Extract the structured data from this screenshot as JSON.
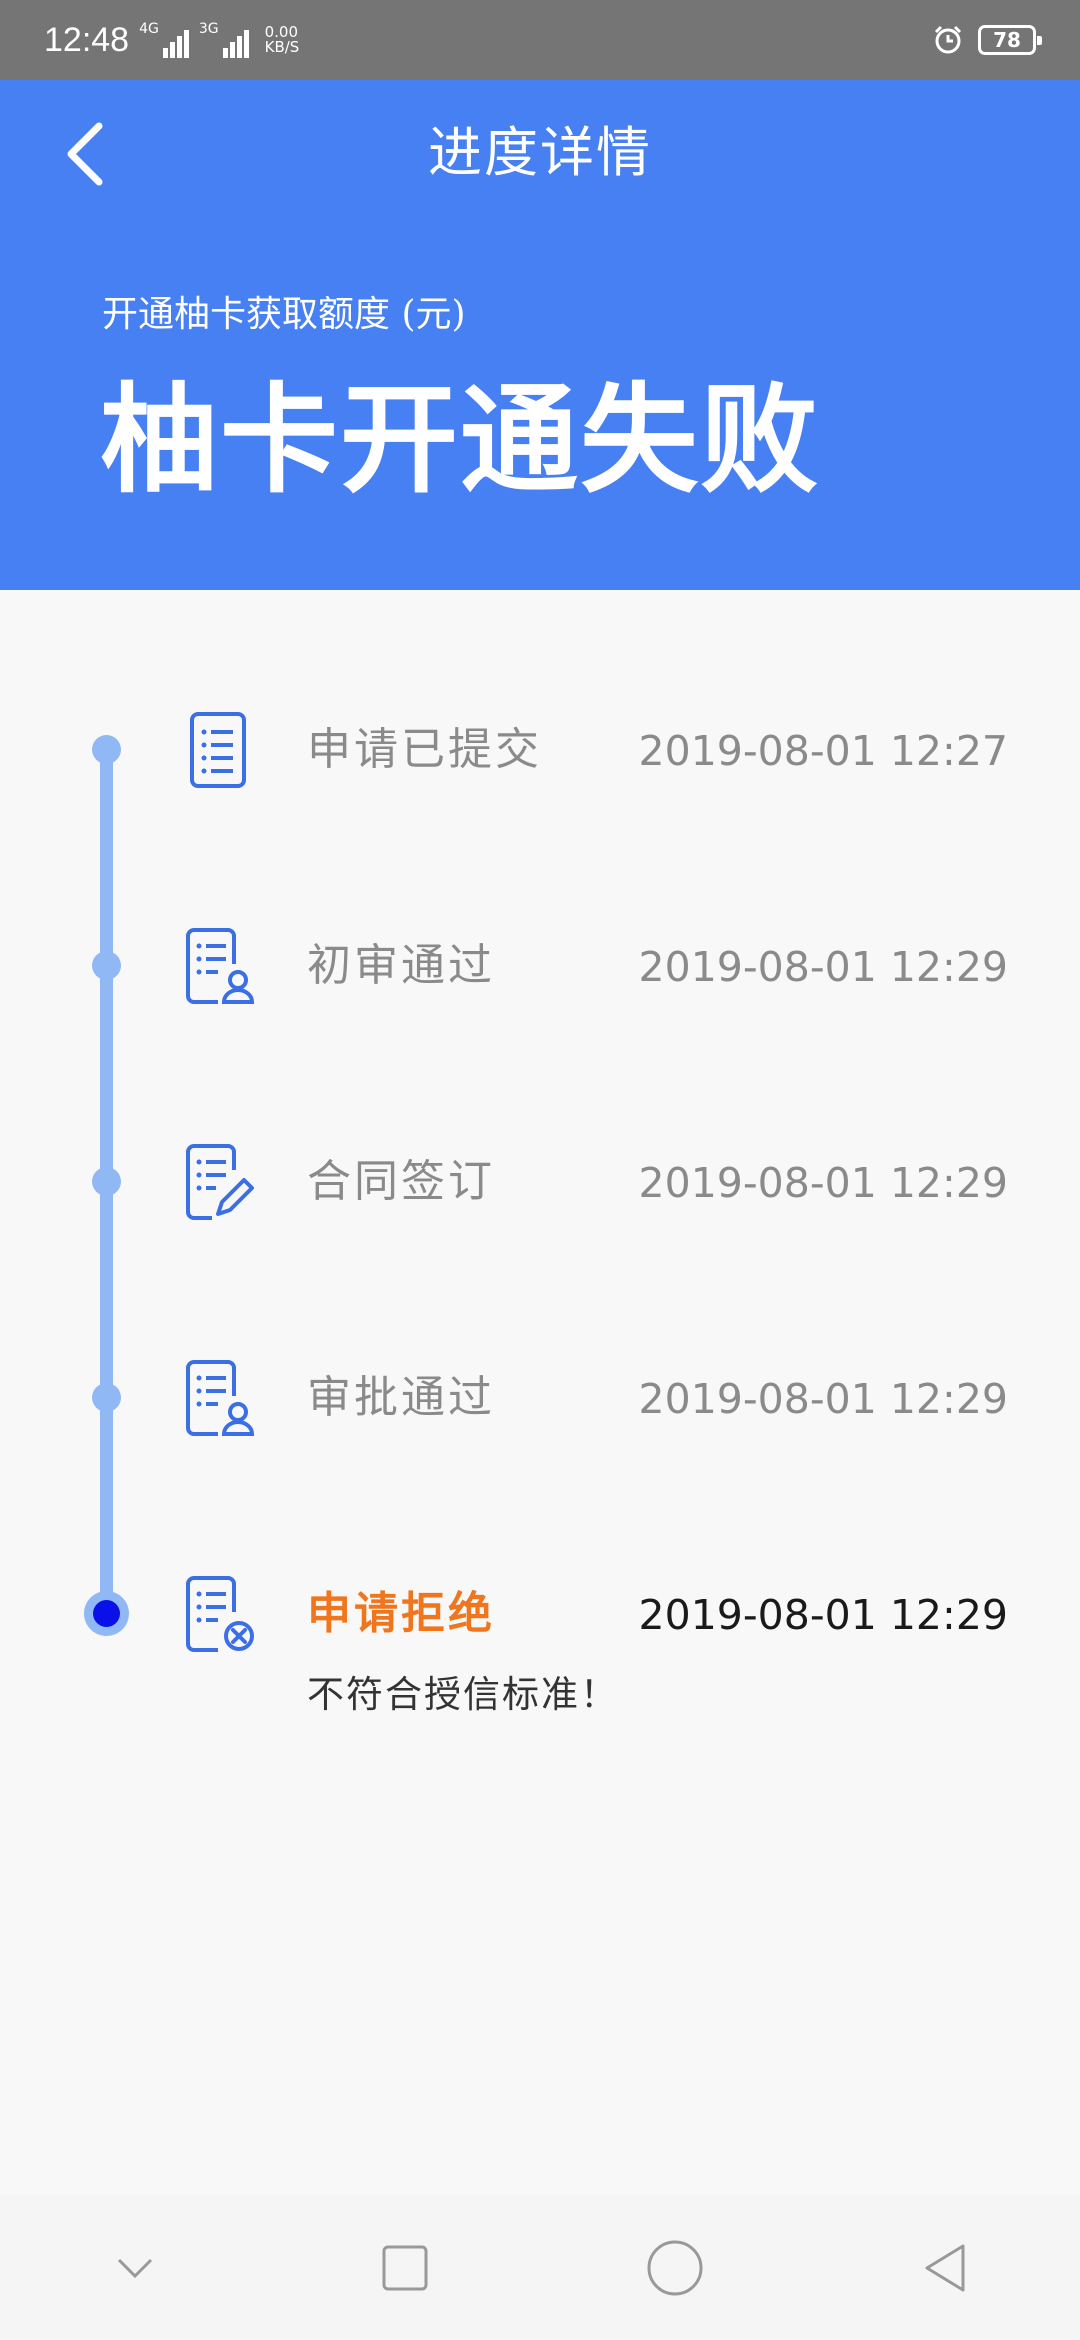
{
  "status_bar": {
    "time": "12:48",
    "network_1": "4G",
    "network_2": "3G",
    "speed_value": "0.00",
    "speed_unit": "KB/S",
    "battery": "78",
    "icons": [
      "signal-icon",
      "signal-icon",
      "alarm-icon",
      "battery-icon"
    ]
  },
  "header": {
    "title": "进度详情",
    "subtitle": "开通柚卡获取额度 (元)",
    "status": "柚卡开通失败",
    "color": "#4780f2"
  },
  "timeline": {
    "steps": [
      {
        "label": "申请已提交",
        "time": "2019-08-01 12:27",
        "icon": "document-list-icon"
      },
      {
        "label": "初审通过",
        "time": "2019-08-01 12:29",
        "icon": "document-user-icon"
      },
      {
        "label": "合同签订",
        "time": "2019-08-01 12:29",
        "icon": "document-sign-icon"
      },
      {
        "label": "审批通过",
        "time": "2019-08-01 12:29",
        "icon": "document-user-icon"
      },
      {
        "label": "申请拒绝",
        "time": "2019-08-01 12:29",
        "icon": "document-reject-icon",
        "reason": "不符合授信标准！"
      }
    ],
    "colors": {
      "line": "#8fb8f5",
      "active_dot": "#0a10e8",
      "reject": "#f0761e"
    }
  },
  "nav_bar": {
    "icons": [
      "chevron-down-icon",
      "square-icon",
      "circle-icon",
      "triangle-back-icon"
    ]
  }
}
